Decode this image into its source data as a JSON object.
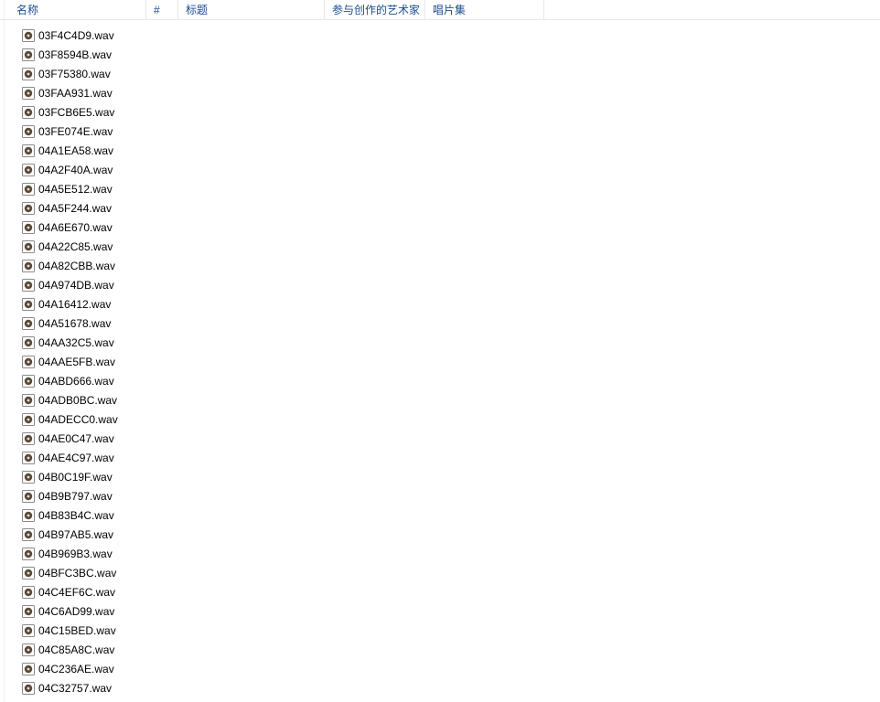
{
  "columns": {
    "name": "名称",
    "number": "#",
    "title": "标题",
    "artist": "参与创作的艺术家",
    "album": "唱片集"
  },
  "files": [
    {
      "name": "03F4C4D9.wav"
    },
    {
      "name": "03F8594B.wav"
    },
    {
      "name": "03F75380.wav"
    },
    {
      "name": "03FAA931.wav"
    },
    {
      "name": "03FCB6E5.wav"
    },
    {
      "name": "03FE074E.wav"
    },
    {
      "name": "04A1EA58.wav"
    },
    {
      "name": "04A2F40A.wav"
    },
    {
      "name": "04A5E512.wav"
    },
    {
      "name": "04A5F244.wav"
    },
    {
      "name": "04A6E670.wav"
    },
    {
      "name": "04A22C85.wav"
    },
    {
      "name": "04A82CBB.wav"
    },
    {
      "name": "04A974DB.wav"
    },
    {
      "name": "04A16412.wav"
    },
    {
      "name": "04A51678.wav"
    },
    {
      "name": "04AA32C5.wav"
    },
    {
      "name": "04AAE5FB.wav"
    },
    {
      "name": "04ABD666.wav"
    },
    {
      "name": "04ADB0BC.wav"
    },
    {
      "name": "04ADECC0.wav"
    },
    {
      "name": "04AE0C47.wav"
    },
    {
      "name": "04AE4C97.wav"
    },
    {
      "name": "04B0C19F.wav"
    },
    {
      "name": "04B9B797.wav"
    },
    {
      "name": "04B83B4C.wav"
    },
    {
      "name": "04B97AB5.wav"
    },
    {
      "name": "04B969B3.wav"
    },
    {
      "name": "04BFC3BC.wav"
    },
    {
      "name": "04C4EF6C.wav"
    },
    {
      "name": "04C6AD99.wav"
    },
    {
      "name": "04C15BED.wav"
    },
    {
      "name": "04C85A8C.wav"
    },
    {
      "name": "04C236AE.wav"
    },
    {
      "name": "04C32757.wav"
    }
  ]
}
